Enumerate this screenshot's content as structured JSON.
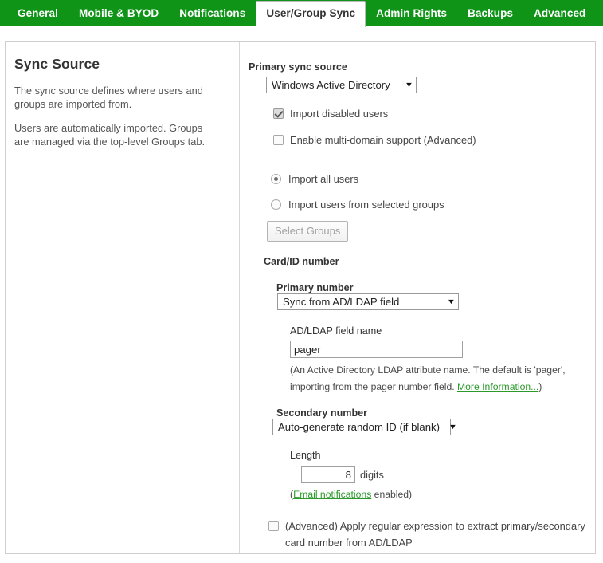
{
  "tabs": [
    {
      "label": "General",
      "active": false
    },
    {
      "label": "Mobile & BYOD",
      "active": false
    },
    {
      "label": "Notifications",
      "active": false
    },
    {
      "label": "User/Group Sync",
      "active": true
    },
    {
      "label": "Admin Rights",
      "active": false
    },
    {
      "label": "Backups",
      "active": false
    },
    {
      "label": "Advanced",
      "active": false
    }
  ],
  "colors": {
    "brand_green": "#0f9418",
    "link_green": "#2b9a2b",
    "panel_border": "#cfcfcf"
  },
  "left": {
    "heading": "Sync Source",
    "paragraph1": "The sync source defines where users and groups are imported from.",
    "paragraph2": "Users are automatically imported. Groups are managed via the top-level Groups tab."
  },
  "right": {
    "primary_sync_source_label": "Primary sync source",
    "primary_sync_source_value": "Windows Active Directory",
    "import_disabled_users_label": "Import disabled users",
    "import_disabled_users_checked": true,
    "enable_multidomain_label": "Enable multi-domain support (Advanced)",
    "enable_multidomain_checked": false,
    "import_all_users_label": "Import all users",
    "import_all_users_selected": true,
    "import_selected_groups_label": "Import users from selected groups",
    "import_selected_groups_selected": false,
    "select_groups_button": "Select Groups",
    "card_id_heading": "Card/ID number",
    "primary_number_label": "Primary number",
    "primary_number_value": "Sync from AD/LDAP field",
    "ad_field_name_label": "AD/LDAP field name",
    "ad_field_name_value": "pager",
    "ad_field_help_part1": "(An Active Directory LDAP attribute name. The default is 'pager', importing from the pager number field. ",
    "ad_field_help_link": "More Information...",
    "ad_field_help_part2": ")",
    "secondary_number_label": "Secondary number",
    "secondary_number_value": "Auto-generate random ID (if blank)",
    "length_label": "Length",
    "length_value": "8",
    "length_units": "digits",
    "email_note_open": "(",
    "email_note_link": "Email notifications",
    "email_note_rest": " enabled)",
    "advanced_regex_label": "(Advanced) Apply regular expression to extract primary/secondary card number from AD/LDAP",
    "advanced_regex_checked": false
  },
  "icons": {
    "caret": "▼"
  }
}
